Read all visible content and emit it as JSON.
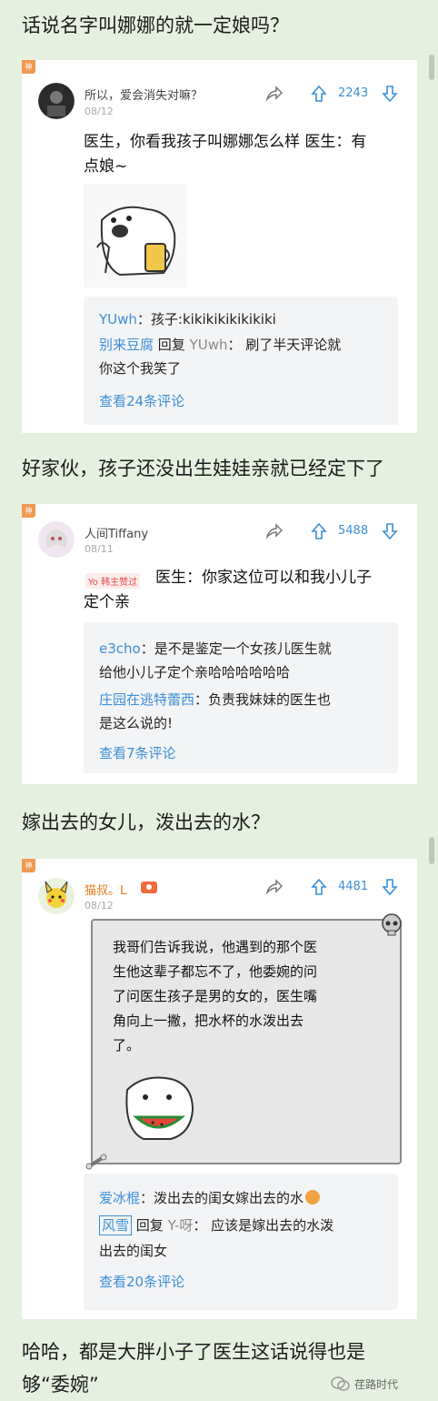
{
  "captions": {
    "c1": "话说名字叫娜娜的就一定娘吗？",
    "c2": "好家伙，孩子还没出生娃娃亲就已经定下了",
    "c3": "嫁出去的女儿，泼出去的水？",
    "c4_line1": "哈哈，都是大胖小子了医生这话说得也是",
    "c4_line2": "够“委婉”"
  },
  "god_badge": "神",
  "posts": [
    {
      "user": "所以，爱会消失对嘛？",
      "date": "08/12",
      "count": "2243",
      "body_line1": "医生，你看我孩子叫娜娜怎么样 医生：有",
      "body_line2": "点娘~",
      "comments": {
        "c1_user": "YUwh",
        "c1_text": "：孩子:kikikikikikikiki",
        "c2_user": "别来豆腐",
        "c2_reply": " 回复 ",
        "c2_target": "YUwh",
        "c2_text": "： 刷了半天评论就",
        "c2_text2": "你这个我笑了",
        "more": "查看24条评论"
      }
    },
    {
      "user": "人间Tiffany",
      "date": "08/11",
      "count": "5488",
      "badge": "Yo 韩主赞过",
      "body_line1": "医生：你家这位可以和我小儿子",
      "body_line2": "定个亲",
      "comments": {
        "c1_user": "e3cho",
        "c1_text": "：是不是鉴定一个女孩儿医生就",
        "c1_text2": "给他小儿子定个亲哈哈哈哈哈哈",
        "c2_user": "庄园在逃特蕾西",
        "c2_text": "：负责我妹妹的医生也",
        "c2_text2": "是这么说的!",
        "more": "查看7条评论"
      }
    },
    {
      "user": "猫叔。L",
      "date": "08/12",
      "count": "4481",
      "scroll_lines": [
        "我哥们告诉我说，他遇到的那个医",
        "生他这辈子都忘不了，他委婉的问",
        "了问医生孩子是男的女的，医生嘴",
        "角向上一撇，把水杯的水泼出去",
        "了。"
      ],
      "comments": {
        "c1_user": "爱冰棍",
        "c1_text": "：泼出去的闺女嫁出去的水",
        "c2_user": "风雪",
        "c2_reply": " 回复 ",
        "c2_target": "Y-呀",
        "c2_text": "： 应该是嫁出去的水泼",
        "c2_text2": "出去的闺女",
        "more": "查看20条评论"
      }
    }
  ],
  "watermark": "荏路时代"
}
